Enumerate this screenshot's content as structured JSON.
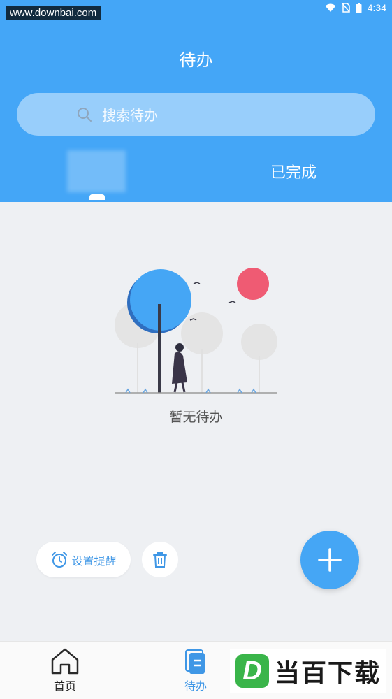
{
  "status_bar": {
    "watermark": "www.downbai.com",
    "time": "4:34"
  },
  "header": {
    "title": "待办"
  },
  "search": {
    "placeholder": "搜索待办"
  },
  "tabs": [
    {
      "label": ""
    },
    {
      "label": "已完成"
    }
  ],
  "empty_state": {
    "text": "暂无待办"
  },
  "actions": {
    "reminder_label": "设置提醒"
  },
  "bottom_nav": [
    {
      "label": "首页"
    },
    {
      "label": "待办"
    }
  ],
  "overlay_logo": {
    "letter": "D",
    "text": "当百下载"
  },
  "colors": {
    "primary": "#44a6f7",
    "accent": "#3f97e6",
    "background": "#eef0f3",
    "tree_red": "#ef5b73"
  }
}
